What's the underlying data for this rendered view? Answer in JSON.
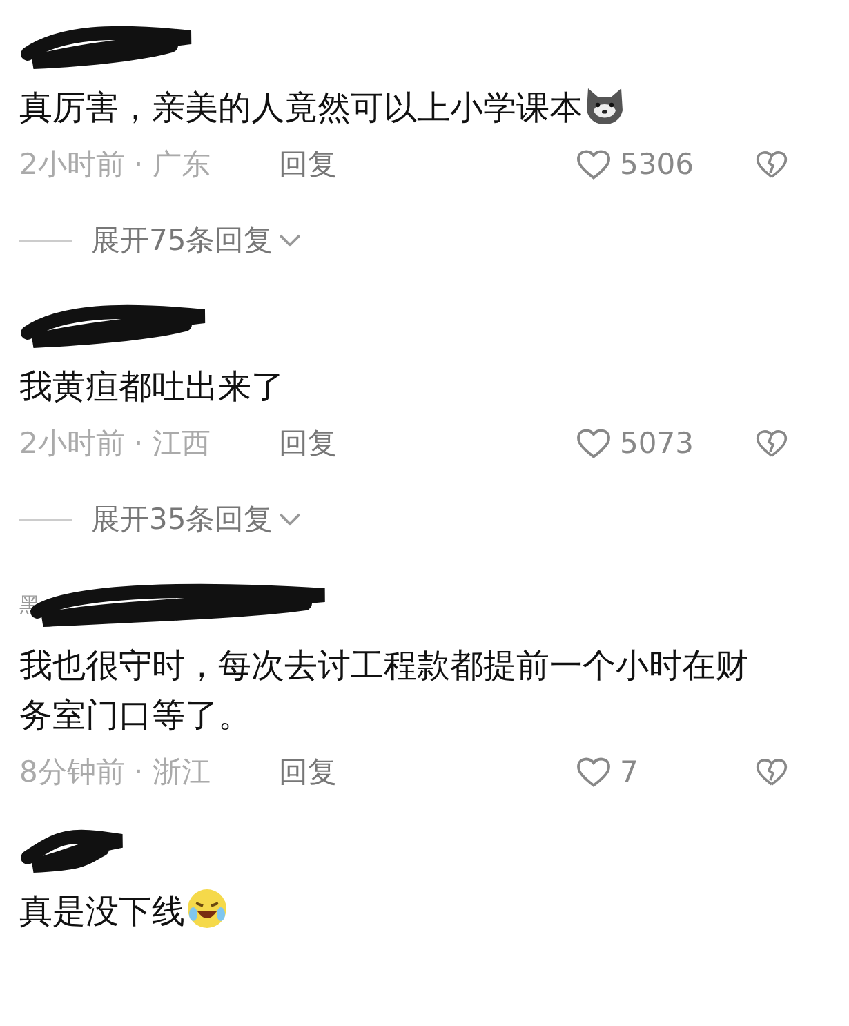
{
  "comments": [
    {
      "kind": "dog",
      "text": "真厉害，亲美的人竟然可以上小学课本",
      "time_location": "2小时前 · 广东",
      "reply": "回复",
      "likes": "5306",
      "liked": false,
      "replies_label": "展开75条回复"
    },
    {
      "kind": "plain",
      "text": "我黄疸都吐出来了",
      "time_location": "2小时前 · 江西",
      "reply": "回复",
      "likes": "5073",
      "liked": false,
      "replies_label": "展开35条回复"
    },
    {
      "kind": "plain",
      "username": "黑",
      "text": "我也很守时，每次去讨工程款都提前一个小时在财务室门口等了。",
      "time_location": "8分钟前 · 浙江",
      "reply": "回复",
      "likes": "7",
      "liked": false
    },
    {
      "kind": "laugh",
      "text": "真是没下线"
    }
  ]
}
